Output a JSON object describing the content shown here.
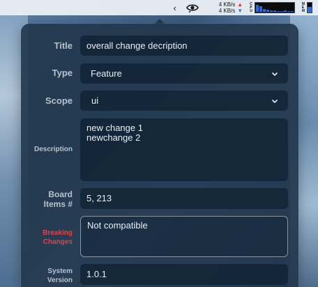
{
  "menubar": {
    "chevron": "‹",
    "net": {
      "up": "4 KB/s",
      "down": "4 KB/s",
      "up_arrow": "▲",
      "down_arrow": "▼"
    },
    "cpu_label": [
      "C",
      "P",
      "U"
    ],
    "cpu_load": [
      0.7,
      0.55,
      0.3,
      0.2,
      0.15,
      0.12,
      0.1,
      0.1,
      0.12,
      0.1,
      0.08
    ],
    "mem_label": [
      "M",
      "E",
      "M"
    ],
    "mem_level": 0.6,
    "colors": {
      "graph": "#2d6cdf",
      "up": "#d8373f",
      "down": "#2e79d6"
    },
    "app_icon": "eye-swirl-icon"
  },
  "form": {
    "title_label": "Title",
    "title_value": "overall change decription",
    "type_label": "Type",
    "type_value": "Feature",
    "scope_label": "Scope",
    "scope_value": "ui",
    "description_label": "Description",
    "description_lines": [
      "new change 1",
      "newchange 2"
    ],
    "board_label_1": "Board",
    "board_label_2": "Items #",
    "board_value": "5, 213",
    "breaking_label_1": "Breaking",
    "breaking_label_2": "Changes",
    "breaking_value": "Not compatible",
    "system_label_1": "System",
    "system_label_2": "Version",
    "system_value": "1.0.1",
    "colors": {
      "breaking_label": "#e0434c",
      "label": "#b8c2cc"
    }
  }
}
